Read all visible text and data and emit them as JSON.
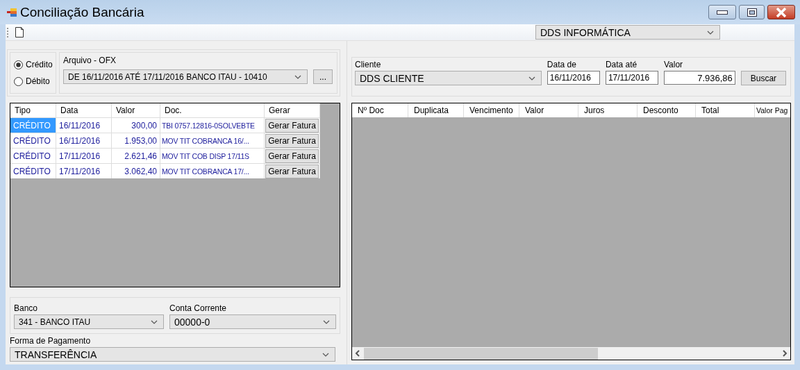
{
  "window": {
    "title": "Conciliação Bancária"
  },
  "toolbar": {
    "company": "DDS INFORMÁTICA"
  },
  "import": {
    "options": [
      {
        "label": "Crédito",
        "selected": true
      },
      {
        "label": "Débito",
        "selected": false
      }
    ],
    "file_label": "Arquivo - OFX",
    "file": "DE 16/11/2016 ATÉ 17/11/2016 BANCO ITAU - 10410",
    "browse": "..."
  },
  "transactions": {
    "columns": [
      "Tipo",
      "Data",
      "Valor",
      "Doc.",
      "Gerar"
    ],
    "rows": [
      {
        "tipo": "CRÉDITO",
        "data": "16/11/2016",
        "valor": "300,00",
        "doc": "TBI 0757.12816-0SOLVEBTE",
        "action": "Gerar Fatura",
        "selected": true
      },
      {
        "tipo": "CRÉDITO",
        "data": "16/11/2016",
        "valor": "1.953,00",
        "doc": "MOV TIT COBRANCA  16/...",
        "action": "Gerar Fatura",
        "selected": false
      },
      {
        "tipo": "CRÉDITO",
        "data": "17/11/2016",
        "valor": "2.621,46",
        "doc": "MOV TIT COB DISP  17/11S",
        "action": "Gerar Fatura",
        "selected": false
      },
      {
        "tipo": "CRÉDITO",
        "data": "17/11/2016",
        "valor": "3.062,40",
        "doc": "MOV TIT COBRANCA  17/...",
        "action": "Gerar Fatura",
        "selected": false
      }
    ]
  },
  "bank": {
    "bank_label": "Banco",
    "bank": "341 - BANCO ITAU",
    "account_label": "Conta Corrente",
    "account": "00000-0"
  },
  "payment": {
    "label": "Forma de Pagamento",
    "value": "TRANSFERÊNCIA"
  },
  "search": {
    "client_label": "Cliente",
    "client": "DDS CLIENTE",
    "date_from_label": "Data de",
    "date_from": "16/11/2016",
    "date_to_label": "Data até",
    "date_to": "17/11/2016",
    "amount_label": "Valor",
    "amount": "7.936,86",
    "button": "Buscar"
  },
  "invoices": {
    "columns": [
      "Nº Doc",
      "Duplicata",
      "Vencimento",
      "Valor",
      "Juros",
      "Desconto",
      "Total",
      "Valor Pag"
    ]
  }
}
